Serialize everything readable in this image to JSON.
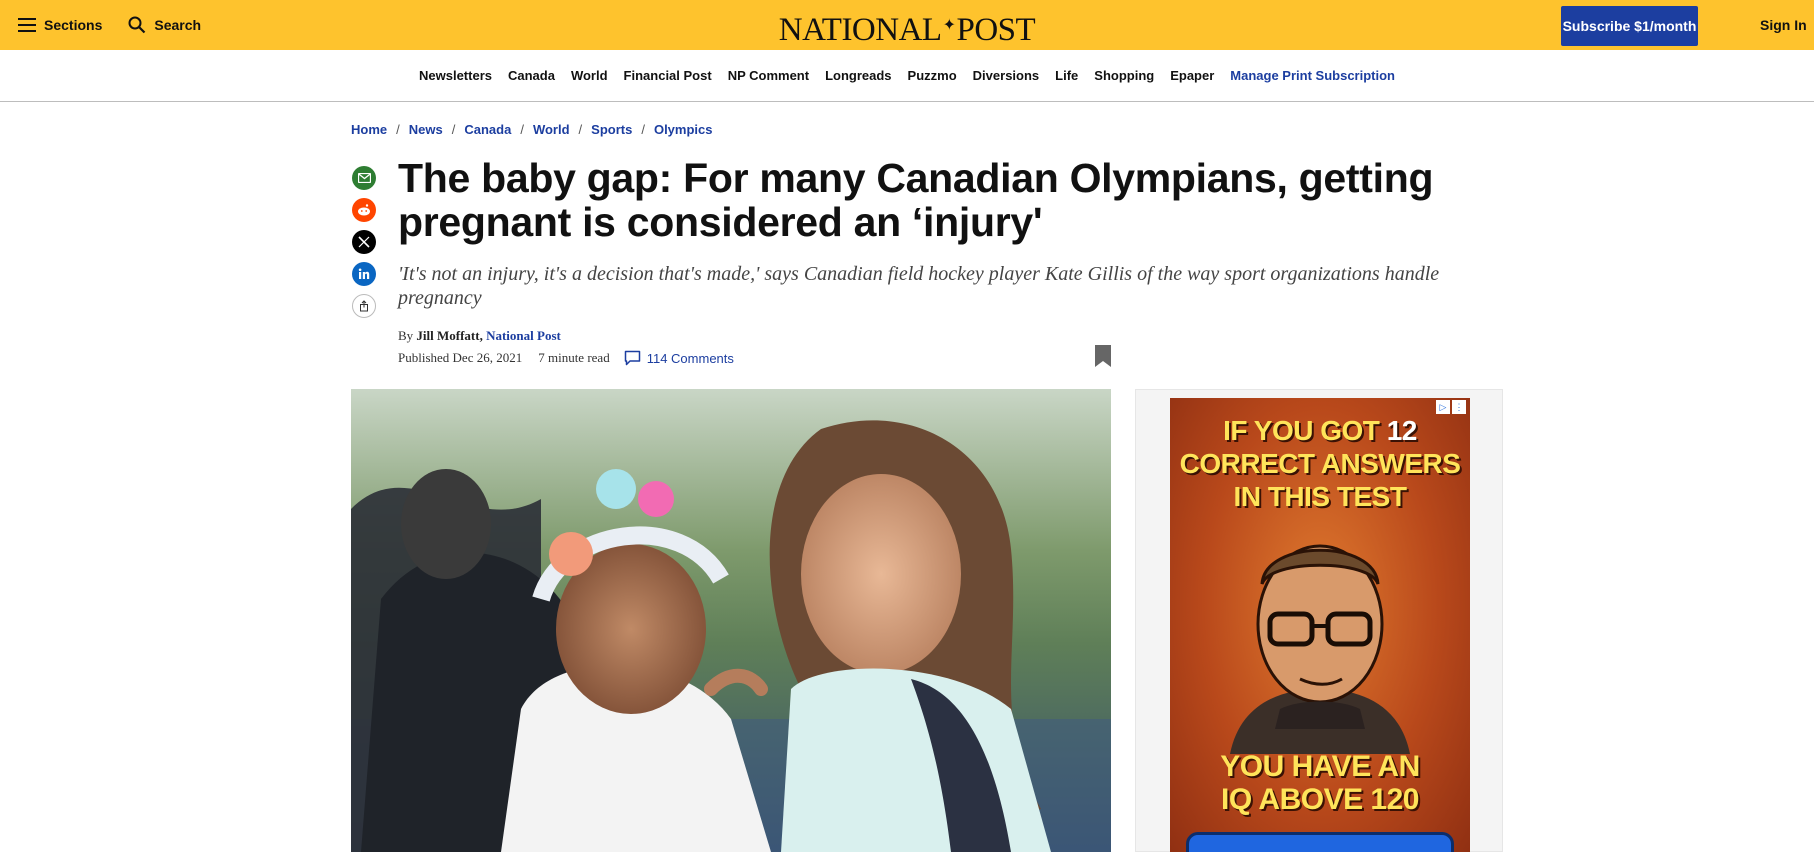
{
  "header": {
    "sections_label": "Sections",
    "search_label": "Search",
    "logo_left": "NATIONAL",
    "logo_right": "POST",
    "subscribe_label": "Subscribe $1/month",
    "signin_label": "Sign In",
    "brand_color": "#fec32d",
    "accent_color": "#1c3ea0"
  },
  "nav": {
    "items": [
      "Newsletters",
      "Canada",
      "World",
      "Financial Post",
      "NP Comment",
      "Longreads",
      "Puzzmo",
      "Diversions",
      "Life",
      "Shopping",
      "Epaper"
    ],
    "manage_label": "Manage Print Subscription"
  },
  "breadcrumb": [
    "Home",
    "News",
    "Canada",
    "World",
    "Sports",
    "Olympics"
  ],
  "share": [
    "email-icon",
    "reddit-icon",
    "x-icon",
    "linkedin-icon",
    "share-icon"
  ],
  "article": {
    "headline": "The baby gap: For many Canadian Olympians, getting pregnant is considered an ‘injury'",
    "deck": "'It's not an injury, it's a decision that's made,' says Canadian field hockey player Kate Gillis of the way sport organizations handle pregnancy",
    "by_prefix": "By",
    "author": "Jill Moffatt,",
    "publication": "National Post",
    "published": "Published Dec 26, 2021",
    "read_time": "7 minute read",
    "comments": "114 Comments"
  },
  "ad": {
    "line1": "IF YOU GOT",
    "number": "12",
    "line2": "CORRECT ANSWERS",
    "line3": "IN THIS TEST",
    "line4": "YOU HAVE AN",
    "line5": "IQ ABOVE 120"
  }
}
